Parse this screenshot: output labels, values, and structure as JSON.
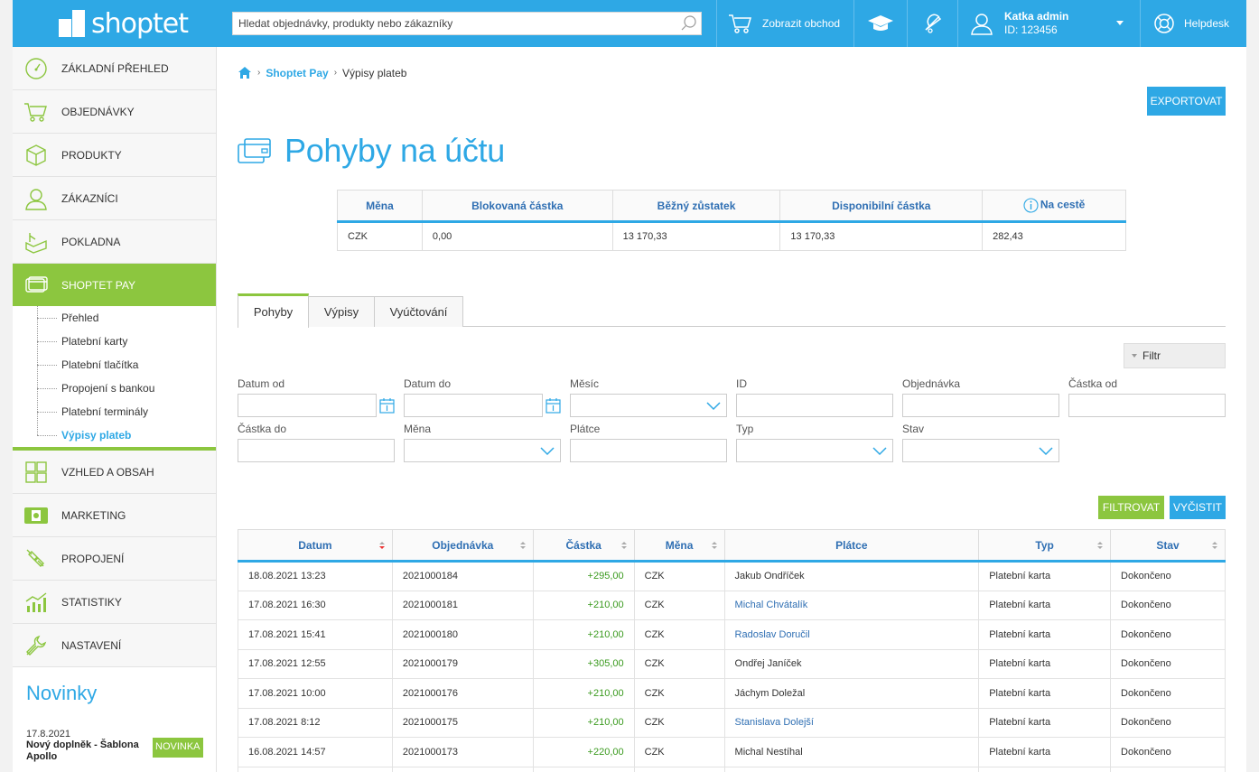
{
  "header": {
    "logo_text": "shoptet",
    "search_placeholder": "Hledat objednávky, produkty nebo zákazníky",
    "view_store": "Zobrazit obchod",
    "user_name": "Katka admin",
    "user_id": "ID: 123456",
    "helpdesk": "Helpdesk"
  },
  "sidebar": {
    "items": [
      {
        "label": "Základní přehled",
        "icon": "dashboard-icon"
      },
      {
        "label": "Objednávky",
        "icon": "cart-icon"
      },
      {
        "label": "Produkty",
        "icon": "box-icon"
      },
      {
        "label": "Zákazníci",
        "icon": "user-icon"
      },
      {
        "label": "Pokladna",
        "icon": "cash-register-icon"
      },
      {
        "label": "Shoptet Pay",
        "icon": "card-icon"
      },
      {
        "label": "Vzhled a obsah",
        "icon": "layout-icon"
      },
      {
        "label": "Marketing",
        "icon": "marketing-icon"
      },
      {
        "label": "Propojení",
        "icon": "plug-icon"
      },
      {
        "label": "Statistiky",
        "icon": "chart-icon"
      },
      {
        "label": "Nastavení",
        "icon": "wrench-icon"
      }
    ],
    "submenu": [
      "Přehled",
      "Platební karty",
      "Platební tlačítka",
      "Propojení s bankou",
      "Platební terminály",
      "Výpisy plateb"
    ],
    "news_heading": "Novinky",
    "news_date": "17.8.2021",
    "news_title": "Nový doplněk - Šablona Apollo",
    "news_badge": "NOVINKA"
  },
  "breadcrumb": {
    "section": "Shoptet Pay",
    "current": "Výpisy plateb"
  },
  "export_label": "EXPORTOVAT",
  "page_title": "Pohyby na účtu",
  "balance": {
    "headers": [
      "Měna",
      "Blokovaná částka",
      "Běžný zůstatek",
      "Disponibilní částka",
      "Na cestě"
    ],
    "row": [
      "CZK",
      "0,00",
      "13 170,33",
      "13 170,33",
      "282,43"
    ]
  },
  "tabs": [
    "Pohyby",
    "Výpisy",
    "Vyúčtování"
  ],
  "filter_toggle": "Filtr",
  "filters": {
    "datum_od": "Datum od",
    "datum_do": "Datum do",
    "mesic": "Měsíc",
    "id": "ID",
    "objednavka": "Objednávka",
    "castka_od": "Částka od",
    "castka_do": "Částka do",
    "mena": "Měna",
    "platce": "Plátce",
    "typ": "Typ",
    "stav": "Stav"
  },
  "filter_btn": "FILTROVAT",
  "clear_btn": "VYČISTIT",
  "table": {
    "headers": [
      "Datum",
      "Objednávka",
      "Částka",
      "Měna",
      "Plátce",
      "Typ",
      "Stav"
    ],
    "rows": [
      {
        "datum": "18.08.2021 13:23",
        "obj": "2021000184",
        "castka": "+295,00",
        "mena": "CZK",
        "platce": "Jakub Ondříček",
        "typ": "Platební karta",
        "stav": "Dokončeno"
      },
      {
        "datum": "17.08.2021 16:30",
        "obj": "2021000181",
        "castka": "+210,00",
        "mena": "CZK",
        "platce": "Michal Chvátalík",
        "typ": "Platební karta",
        "stav": "Dokončeno"
      },
      {
        "datum": "17.08.2021 15:41",
        "obj": "2021000180",
        "castka": "+210,00",
        "mena": "CZK",
        "platce": "Radoslav Doručil",
        "typ": "Platební karta",
        "stav": "Dokončeno"
      },
      {
        "datum": "17.08.2021 12:55",
        "obj": "2021000179",
        "castka": "+305,00",
        "mena": "CZK",
        "platce": "Ondřej Janíček",
        "typ": "Platební karta",
        "stav": "Dokončeno"
      },
      {
        "datum": "17.08.2021 10:00",
        "obj": "2021000176",
        "castka": "+210,00",
        "mena": "CZK",
        "platce": "Jáchym Doležal",
        "typ": "Platební karta",
        "stav": "Dokončeno"
      },
      {
        "datum": "17.08.2021 8:12",
        "obj": "2021000175",
        "castka": "+210,00",
        "mena": "CZK",
        "platce": "Stanislava Dolejší",
        "typ": "Platební karta",
        "stav": "Dokončeno"
      },
      {
        "datum": "16.08.2021 14:57",
        "obj": "2021000173",
        "castka": "+220,00",
        "mena": "CZK",
        "platce": "Michal Nestíhal",
        "typ": "Platební karta",
        "stav": "Dokončeno"
      }
    ]
  },
  "colors": {
    "accent": "#2ea8e5",
    "active": "#8cc63f",
    "positive": "#3a9a1e"
  }
}
